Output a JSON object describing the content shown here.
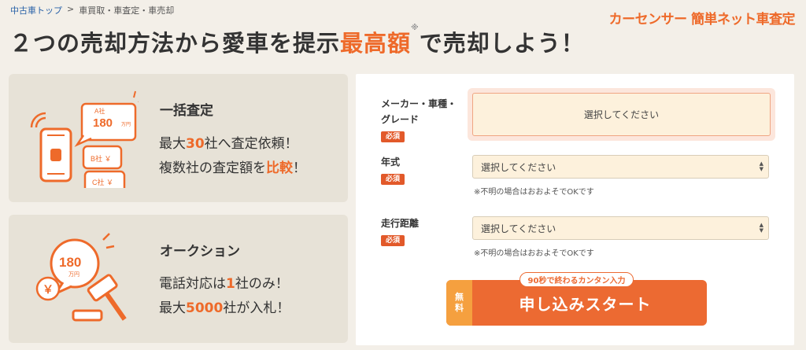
{
  "breadcrumb": {
    "home": "中古車トップ",
    "sep": ">",
    "current": "車買取・車査定・車売却"
  },
  "brand": "カーセンサー 簡単ネット車査定",
  "headline": {
    "pre": "２つの売却方法から愛車を提示",
    "highlight": "最高額",
    "mark": "※",
    "post": "で売却しよう！"
  },
  "card1": {
    "title": "一括査定",
    "line1": {
      "a": "最大",
      "num": "30",
      "b": "社へ査定依頼！"
    },
    "line2": {
      "a": "複数社の査定額を",
      "num": "比較",
      "b": "！"
    },
    "icon": {
      "bubble_a_company": "A社",
      "bubble_a_amount": "180",
      "bubble_a_unit": "万円",
      "bubble_b": "B社 ￥",
      "bubble_c": "C社 ￥"
    }
  },
  "card2": {
    "title": "オークション",
    "line1": {
      "a": "電話対応は",
      "num": "1",
      "b": "社のみ！"
    },
    "line2": {
      "a": "最大",
      "num": "5000",
      "b": "社が入札！"
    },
    "icon": {
      "amount": "180",
      "unit": "万円",
      "yen": "￥"
    }
  },
  "form": {
    "maker": {
      "label_line1": "メーカー・車種・",
      "label_line2": "グレード",
      "required": "必須",
      "value": "選択してください"
    },
    "year": {
      "label": "年式",
      "required": "必須",
      "value": "選択してください",
      "note": "※不明の場合はおおよそでOKです"
    },
    "mileage": {
      "label": "走行距離",
      "required": "必須",
      "value": "選択してください",
      "note": "※不明の場合はおおよそでOKです"
    },
    "button": {
      "free_1": "無",
      "free_2": "料",
      "tag": "90秒で終わるカンタン入力",
      "label": "申し込みスタート"
    }
  },
  "colors": {
    "accent": "#ee6a2a",
    "background": "#f3efe8",
    "card": "#e7e2d7",
    "free_badge": "#f5a03f"
  }
}
